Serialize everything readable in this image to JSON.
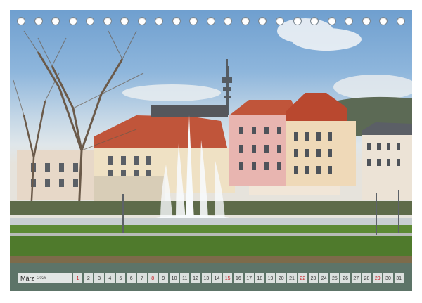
{
  "calendar": {
    "month": "März",
    "year": "2026",
    "days": [
      {
        "n": "1",
        "sunday": true
      },
      {
        "n": "2",
        "sunday": false
      },
      {
        "n": "3",
        "sunday": false
      },
      {
        "n": "4",
        "sunday": false
      },
      {
        "n": "5",
        "sunday": false
      },
      {
        "n": "6",
        "sunday": false
      },
      {
        "n": "7",
        "sunday": false
      },
      {
        "n": "8",
        "sunday": true
      },
      {
        "n": "9",
        "sunday": false
      },
      {
        "n": "10",
        "sunday": false
      },
      {
        "n": "11",
        "sunday": false
      },
      {
        "n": "12",
        "sunday": false
      },
      {
        "n": "13",
        "sunday": false
      },
      {
        "n": "14",
        "sunday": false
      },
      {
        "n": "15",
        "sunday": true
      },
      {
        "n": "16",
        "sunday": false
      },
      {
        "n": "17",
        "sunday": false
      },
      {
        "n": "18",
        "sunday": false
      },
      {
        "n": "19",
        "sunday": false
      },
      {
        "n": "20",
        "sunday": false
      },
      {
        "n": "21",
        "sunday": false
      },
      {
        "n": "22",
        "sunday": true
      },
      {
        "n": "23",
        "sunday": false
      },
      {
        "n": "24",
        "sunday": false
      },
      {
        "n": "25",
        "sunday": false
      },
      {
        "n": "26",
        "sunday": false
      },
      {
        "n": "27",
        "sunday": false
      },
      {
        "n": "28",
        "sunday": false
      },
      {
        "n": "29",
        "sunday": true
      },
      {
        "n": "30",
        "sunday": false
      },
      {
        "n": "31",
        "sunday": false
      }
    ]
  },
  "binding": {
    "ring_count": 23
  },
  "colors": {
    "sunday": "#c4161c",
    "roof": "#c0553a",
    "lawn": "#4f7a2c",
    "water": "#5d7468"
  }
}
